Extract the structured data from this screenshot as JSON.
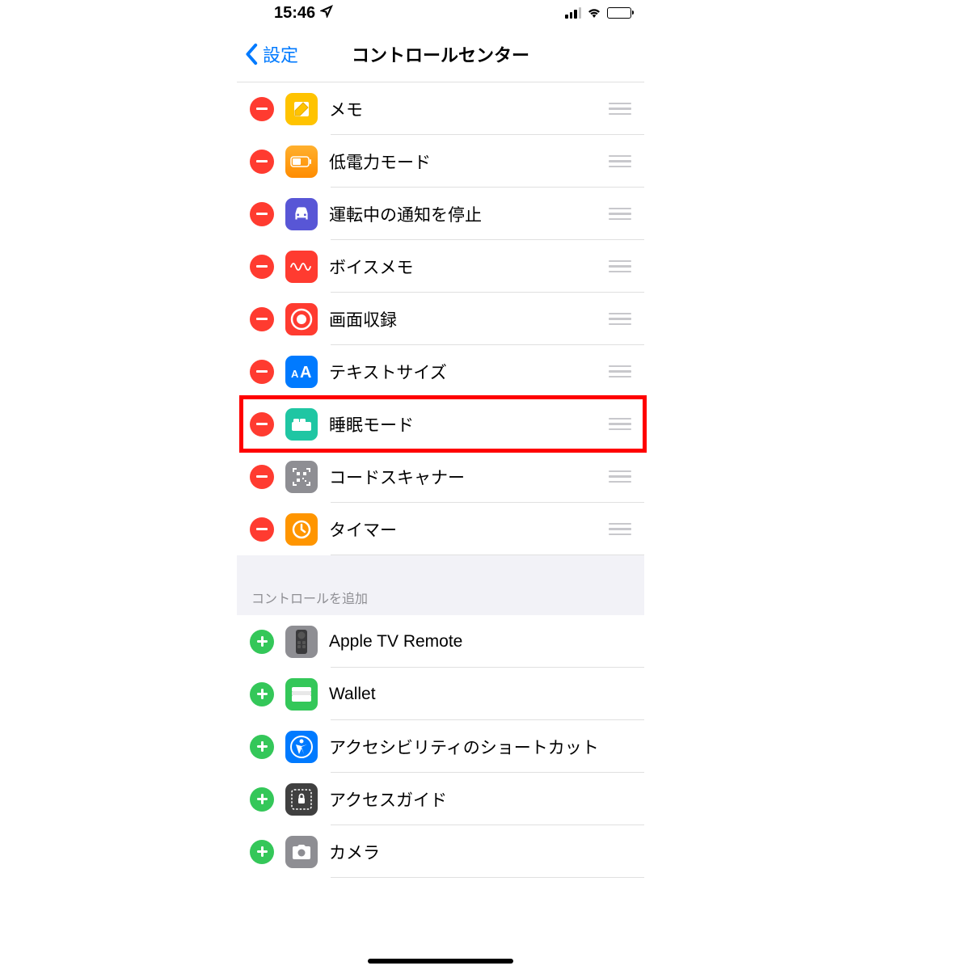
{
  "statusBar": {
    "time": "15:46"
  },
  "nav": {
    "back": "設定",
    "title": "コントロールセンター"
  },
  "included": [
    {
      "key": "notes",
      "label": "メモ",
      "iconBg": "#ffc300"
    },
    {
      "key": "lowpower",
      "label": "低電力モード",
      "iconBg": "linear-gradient(#ffb02e,#ff8c00)"
    },
    {
      "key": "driving",
      "label": "運転中の通知を停止",
      "iconBg": "#5856d6"
    },
    {
      "key": "voicememo",
      "label": "ボイスメモ",
      "iconBg": "#ff3b30"
    },
    {
      "key": "screenrec",
      "label": "画面収録",
      "iconBg": "#ff3b30"
    },
    {
      "key": "textsize",
      "label": "テキストサイズ",
      "iconBg": "#007aff"
    },
    {
      "key": "sleep",
      "label": "睡眠モード",
      "iconBg": "#1fc6a3",
      "highlighted": true
    },
    {
      "key": "codescan",
      "label": "コードスキャナー",
      "iconBg": "#8e8e93"
    },
    {
      "key": "timer",
      "label": "タイマー",
      "iconBg": "#ff9500"
    }
  ],
  "addMoreHeader": "コントロールを追加",
  "more": [
    {
      "key": "appletv",
      "label": "Apple TV Remote",
      "iconBg": "#8e8e93"
    },
    {
      "key": "wallet",
      "label": "Wallet",
      "iconBg": "#34c759"
    },
    {
      "key": "accessibility",
      "label": "アクセシビリティのショートカット",
      "iconBg": "#007aff"
    },
    {
      "key": "guidedaccess",
      "label": "アクセスガイド",
      "iconBg": "#404040"
    },
    {
      "key": "camera",
      "label": "カメラ",
      "iconBg": "#8e8e93"
    }
  ]
}
